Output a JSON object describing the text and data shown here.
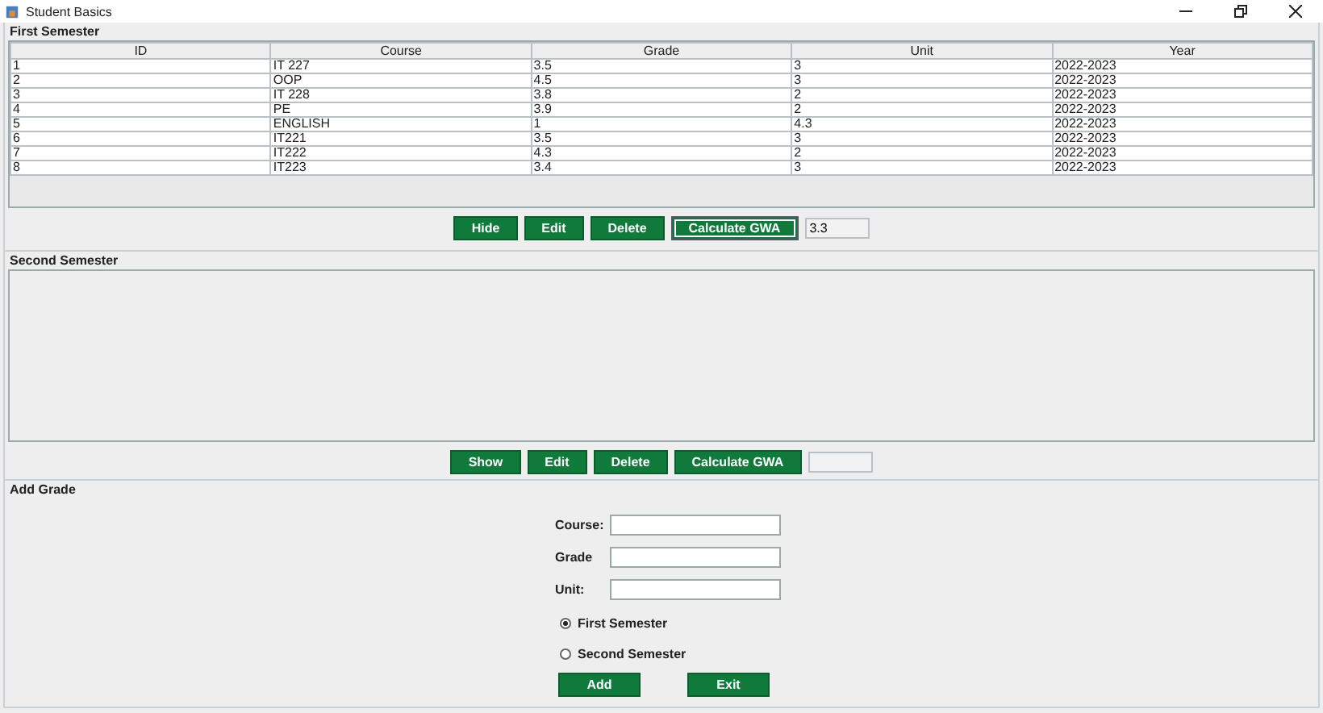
{
  "window": {
    "title": "Student Basics"
  },
  "first_semester": {
    "title": "First Semester",
    "columns": [
      "ID",
      "Course",
      "Grade",
      "Unit",
      "Year"
    ],
    "rows": [
      [
        "1",
        "IT 227",
        "3.5",
        "3",
        "2022-2023"
      ],
      [
        "2",
        "OOP",
        "4.5",
        "3",
        "2022-2023"
      ],
      [
        "3",
        "IT 228",
        "3.8",
        "2",
        "2022-2023"
      ],
      [
        "4",
        "PE",
        "3.9",
        "2",
        "2022-2023"
      ],
      [
        "5",
        "ENGLISH",
        "1",
        "4.3",
        "2022-2023"
      ],
      [
        "6",
        "IT221",
        "3.5",
        "3",
        "2022-2023"
      ],
      [
        "7",
        "IT222",
        "4.3",
        "2",
        "2022-2023"
      ],
      [
        "8",
        "IT223",
        "3.4",
        "3",
        "2022-2023"
      ]
    ],
    "buttons": [
      {
        "label": "Hide",
        "focused": false
      },
      {
        "label": "Edit",
        "focused": false
      },
      {
        "label": "Delete",
        "focused": false
      },
      {
        "label": "Calculate GWA",
        "focused": true
      }
    ],
    "gwa": "3.3"
  },
  "second_semester": {
    "title": "Second Semester",
    "buttons": [
      {
        "label": "Show",
        "focused": false
      },
      {
        "label": "Edit",
        "focused": false
      },
      {
        "label": "Delete",
        "focused": false
      },
      {
        "label": "Calculate GWA",
        "focused": false
      }
    ]
  },
  "add_grade": {
    "title": "Add Grade",
    "fields": [
      {
        "label": "Course:"
      },
      {
        "label": "Grade"
      },
      {
        "label": "Unit:"
      }
    ],
    "radios": [
      {
        "label": "First Semester",
        "selected": true
      },
      {
        "label": "Second Semester",
        "selected": false
      }
    ],
    "buttons": [
      {
        "label": "Add"
      },
      {
        "label": "Exit"
      }
    ]
  }
}
